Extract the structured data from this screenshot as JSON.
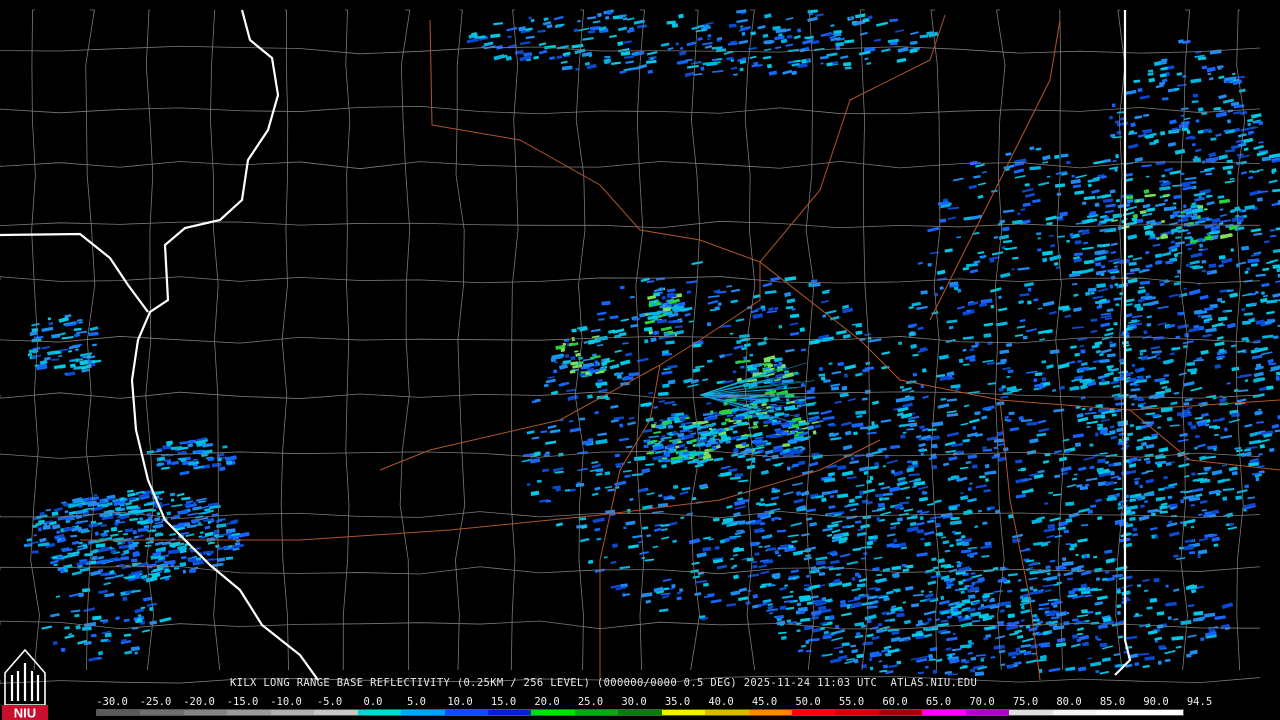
{
  "product_caption": "KILX LONG RANGE BASE REFLECTIVITY (0.25KM / 256 LEVEL) (000000/0000 0.5 DEG) 2025-11-24 11:03 UTC  ATLAS.NIU.EDU",
  "logo_text": "NIU",
  "color_scale": {
    "labels": [
      "-30.0",
      "-25.0",
      "-20.0",
      "-15.0",
      "-10.0",
      "-5.0",
      "0.0",
      "5.0",
      "10.0",
      "15.0",
      "20.0",
      "25.0",
      "30.0",
      "35.0",
      "40.0",
      "45.0",
      "50.0",
      "55.0",
      "60.0",
      "65.0",
      "70.0",
      "75.0",
      "80.0",
      "85.0",
      "90.0",
      "94.5"
    ],
    "colors": [
      "#5a5a5a",
      "#6e6e6e",
      "#848484",
      "#9a9a9a",
      "#b0b0b0",
      "#c8c8c8",
      "#00d8d8",
      "#00a4ff",
      "#0050ff",
      "#0020c8",
      "#00e000",
      "#00b000",
      "#008000",
      "#f0f000",
      "#e0b800",
      "#ff8800",
      "#ff0000",
      "#d00000",
      "#a00000",
      "#ff00ff",
      "#b000d0",
      "#e0e0e0",
      "#f6f6f6",
      "#ffffff",
      "#ffffff"
    ]
  },
  "colors": {
    "background": "#000000",
    "county_lines": "#7a7a7a",
    "state_lines": "#ffffff",
    "highways": "#b0552a",
    "echo_light": "#00c8e6",
    "echo_mid": "#1466ff",
    "echo_strong": "#28d23c"
  },
  "icons": [
    "niu-logo-icon"
  ]
}
